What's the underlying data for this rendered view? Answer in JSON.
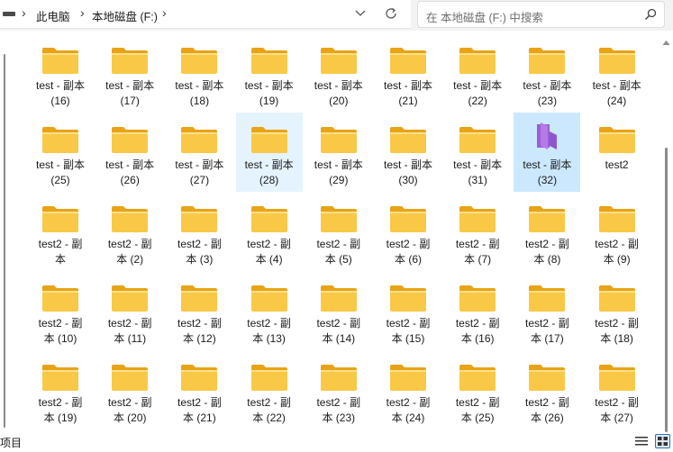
{
  "address_bar": {
    "crumbs": [
      "此电脑",
      "本地磁盘 (F:)"
    ],
    "separator": "›"
  },
  "search": {
    "placeholder": "在 本地磁盘 (F:) 中搜索"
  },
  "status_bar": {
    "text": "项目"
  },
  "icons": {
    "drive": "drive-icon",
    "chevron": "chevron-down-icon",
    "refresh": "refresh-icon",
    "search": "search-icon",
    "folder": "folder-icon",
    "open_folder": "open-folder-icon"
  },
  "colors": {
    "folder": "#f9c846",
    "folder_dark": "#e8a317",
    "open_folder": "#b57ae6",
    "selection": "#cce8ff",
    "hover": "#e5f3ff"
  },
  "items": [
    {
      "label": "test - 副本\n(16)"
    },
    {
      "label": "test - 副本\n(17)"
    },
    {
      "label": "test - 副本\n(18)"
    },
    {
      "label": "test - 副本\n(19)"
    },
    {
      "label": "test - 副本\n(20)"
    },
    {
      "label": "test - 副本\n(21)"
    },
    {
      "label": "test - 副本\n(22)"
    },
    {
      "label": "test - 副本\n(23)"
    },
    {
      "label": "test - 副本\n(24)"
    },
    {
      "label": "test - 副本\n(25)"
    },
    {
      "label": "test - 副本\n(26)"
    },
    {
      "label": "test - 副本\n(27)"
    },
    {
      "label": "test - 副本\n(28)",
      "state": "hover"
    },
    {
      "label": "test - 副本\n(29)"
    },
    {
      "label": "test - 副本\n(30)"
    },
    {
      "label": "test - 副本\n(31)"
    },
    {
      "label": "test - 副本\n(32)",
      "state": "selected",
      "icon": "open-folder-icon"
    },
    {
      "label": "test2"
    },
    {
      "label": "test2 - 副\n本"
    },
    {
      "label": "test2 - 副\n本 (2)"
    },
    {
      "label": "test2 - 副\n本 (3)"
    },
    {
      "label": "test2 - 副\n本 (4)"
    },
    {
      "label": "test2 - 副\n本 (5)"
    },
    {
      "label": "test2 - 副\n本 (6)"
    },
    {
      "label": "test2 - 副\n本 (7)"
    },
    {
      "label": "test2 - 副\n本 (8)"
    },
    {
      "label": "test2 - 副\n本 (9)"
    },
    {
      "label": "test2 - 副\n本 (10)"
    },
    {
      "label": "test2 - 副\n本 (11)"
    },
    {
      "label": "test2 - 副\n本 (12)"
    },
    {
      "label": "test2 - 副\n本 (13)"
    },
    {
      "label": "test2 - 副\n本 (14)"
    },
    {
      "label": "test2 - 副\n本 (15)"
    },
    {
      "label": "test2 - 副\n本 (16)"
    },
    {
      "label": "test2 - 副\n本 (17)"
    },
    {
      "label": "test2 - 副\n本 (18)"
    },
    {
      "label": "test2 - 副\n本 (19)"
    },
    {
      "label": "test2 - 副\n本 (20)"
    },
    {
      "label": "test2 - 副\n本 (21)"
    },
    {
      "label": "test2 - 副\n本 (22)"
    },
    {
      "label": "test2 - 副\n本 (23)"
    },
    {
      "label": "test2 - 副\n本 (24)"
    },
    {
      "label": "test2 - 副\n本 (25)"
    },
    {
      "label": "test2 - 副\n本 (26)"
    },
    {
      "label": "test2 - 副\n本 (27)"
    }
  ]
}
